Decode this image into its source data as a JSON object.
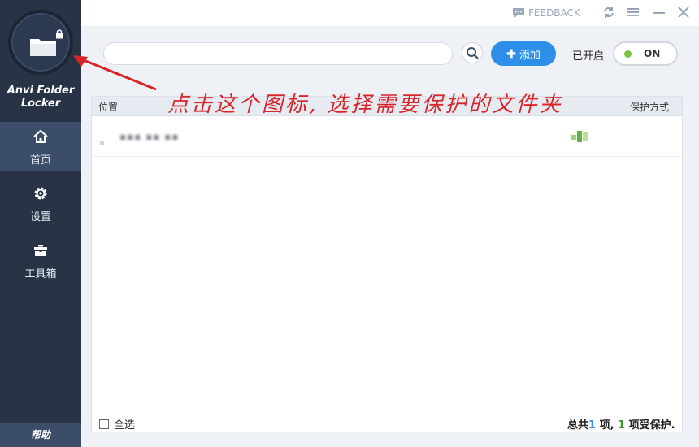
{
  "app": {
    "name_line1": "Anvi Folder",
    "name_line2": "Locker"
  },
  "sidebar": {
    "items": [
      {
        "label": "首页",
        "icon": "home-icon",
        "active": true
      },
      {
        "label": "设置",
        "icon": "gear-icon",
        "active": false
      },
      {
        "label": "工具箱",
        "icon": "toolbox-icon",
        "active": false
      }
    ],
    "help_label": "帮助"
  },
  "titlebar": {
    "feedback_label": "FEEDBACK"
  },
  "toolbar": {
    "search_value": "",
    "add_label": "添加",
    "enabled_label": "已开启",
    "toggle_label": "ON"
  },
  "table": {
    "headers": {
      "location": "位置",
      "mode": "保护方式"
    },
    "rows": [
      {
        "path": "▪▪▪ ▪▪ ▪▪",
        "mode": "lock"
      }
    ]
  },
  "footer": {
    "select_all_label": "全选",
    "summary_prefix": "总共",
    "total_count": "1",
    "summary_mid": " 项, ",
    "protected_count": "1",
    "summary_suffix": " 项受保护."
  },
  "annotation": {
    "text": "点击这个图标, 选择需要保护的文件夹"
  },
  "colors": {
    "sidebar": "#283445",
    "accent": "#2e8fe8",
    "on_dot": "#7cc444",
    "annotation": "#d9242a"
  }
}
